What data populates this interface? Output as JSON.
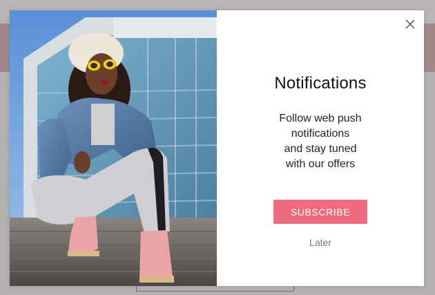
{
  "popup": {
    "title": "Notifications",
    "description_lines": [
      "Follow web push",
      "notifications",
      "and stay tuned",
      "with our offers"
    ],
    "subscribe_label": "SUBSCRIBE",
    "later_label": "Later",
    "close_icon": "close-icon",
    "accent_color": "#ef6b7e"
  },
  "hero_image": {
    "icon": "fashion-photo"
  }
}
